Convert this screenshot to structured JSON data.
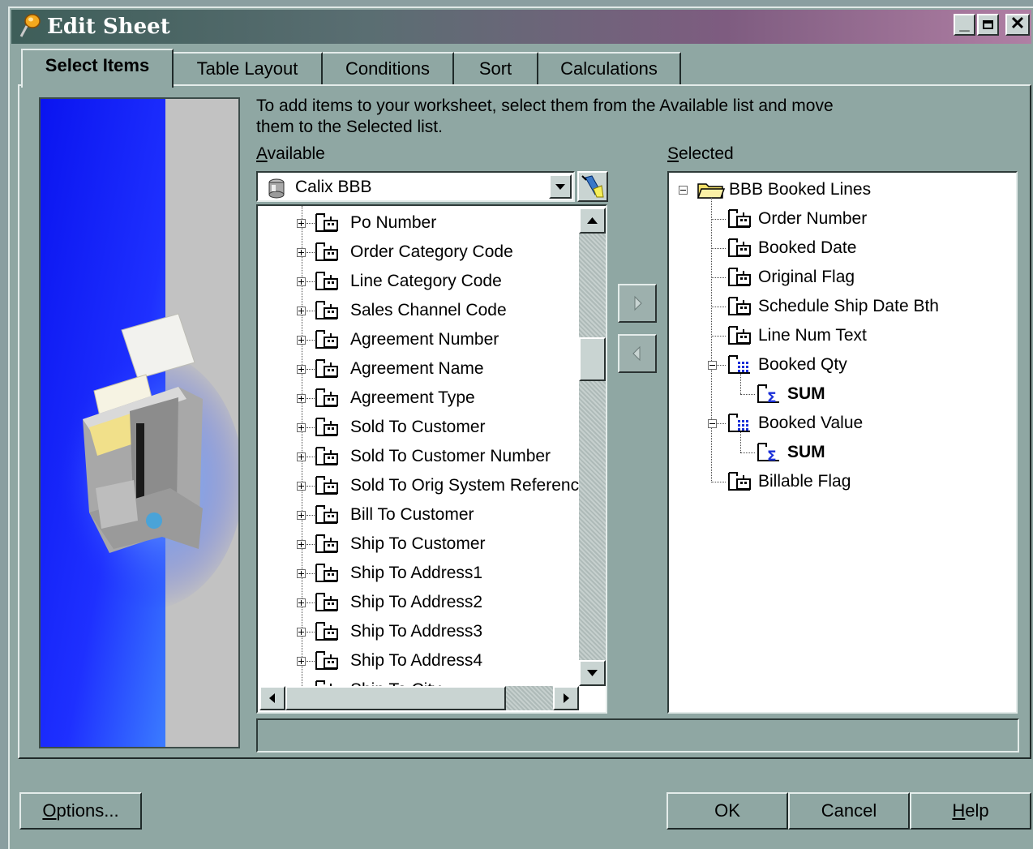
{
  "window": {
    "title": "Edit Sheet"
  },
  "tabs": [
    {
      "label": "Select Items",
      "active": true
    },
    {
      "label": "Table Layout"
    },
    {
      "label": "Conditions"
    },
    {
      "label": "Sort"
    },
    {
      "label": "Calculations"
    }
  ],
  "info_text": "To add items to your worksheet, select them from the Available list and move them to the Selected list.",
  "available": {
    "label_key": "A",
    "label_rest": "vailable",
    "business_area": "Calix BBB",
    "items": [
      "Po Number",
      "Order Category Code",
      "Line Category Code",
      "Sales Channel Code",
      "Agreement Number",
      "Agreement Name",
      "Agreement Type",
      "Sold To Customer",
      "Sold To Customer Number",
      "Sold To Orig System Referenc",
      "Bill To Customer",
      "Ship To Customer",
      "Ship To Address1",
      "Ship To Address2",
      "Ship To Address3",
      "Ship To Address4",
      "Ship To City"
    ]
  },
  "selected": {
    "label_key": "S",
    "label_rest": "elected",
    "folder": "BBB Booked Lines",
    "items": [
      {
        "label": "Order Number",
        "type": "item"
      },
      {
        "label": "Booked Date",
        "type": "item"
      },
      {
        "label": "Original Flag",
        "type": "item"
      },
      {
        "label": "Schedule Ship Date Bth",
        "type": "item"
      },
      {
        "label": "Line Num Text",
        "type": "item"
      },
      {
        "label": "Booked Qty",
        "type": "measure",
        "child": "SUM"
      },
      {
        "label": "Booked Value",
        "type": "measure",
        "child": "SUM"
      },
      {
        "label": "Billable Flag",
        "type": "item"
      }
    ]
  },
  "buttons": {
    "options_key": "O",
    "options_rest": "ptions...",
    "ok": "OK",
    "cancel": "Cancel",
    "help_key": "H",
    "help_rest": "elp"
  },
  "colors": {
    "dialog_bg": "#8fa7a3",
    "graphic_blue": "#0a14f0"
  }
}
